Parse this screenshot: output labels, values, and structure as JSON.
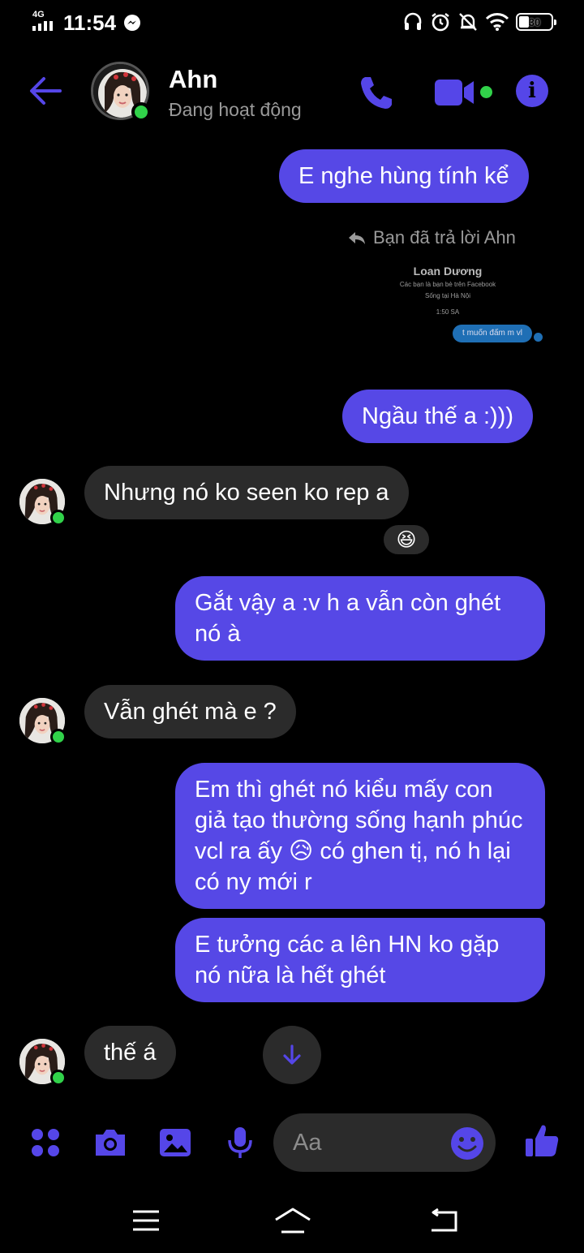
{
  "status_bar": {
    "network": "4G",
    "time": "11:54",
    "battery": "30"
  },
  "header": {
    "name": "Ahn",
    "status": "Đang hoạt động"
  },
  "messages": [
    {
      "text": "E nghe hùng tính kể"
    },
    {
      "text": "Ngầu thế a :)))"
    },
    {
      "text": "Nhưng nó ko seen ko rep a"
    },
    {
      "text": "Gắt vậy a :v h a vẫn còn ghét nó à"
    },
    {
      "text": "Vẫn ghét mà e ?"
    },
    {
      "text": "Em thì ghét nó kiểu mấy con giả tạo thường sống hạnh phúc vcl ra ấy 😥 có ghen tị, nó h lại có ny mới r"
    },
    {
      "text": "E tưởng các a lên HN ko gặp nó nữa là hết ghét"
    },
    {
      "text": "thế á"
    }
  ],
  "reply": {
    "note": "Bạn đã trả lời Ahn",
    "preview_name": "Loan Dương",
    "preview_line1": "Các bạn là bạn bè trên Facebook",
    "preview_line2": "Sống tại Hà Nội",
    "preview_time": "1:50 SA",
    "preview_bubble": "t muốn đấm m vl"
  },
  "reaction": "😆",
  "composer": {
    "placeholder": "Aa"
  },
  "colors": {
    "accent": "#5648e6",
    "incoming_bubble": "#2b2b2b",
    "online": "#31d24a",
    "background": "#000000"
  },
  "icons": [
    "back-arrow-icon",
    "phone-icon",
    "video-camera-icon",
    "info-icon",
    "apps-icon",
    "camera-icon",
    "image-icon",
    "microphone-icon",
    "emoji-icon",
    "thumbs-up-icon",
    "arrow-down-icon",
    "menu-icon",
    "home-icon",
    "return-icon"
  ]
}
